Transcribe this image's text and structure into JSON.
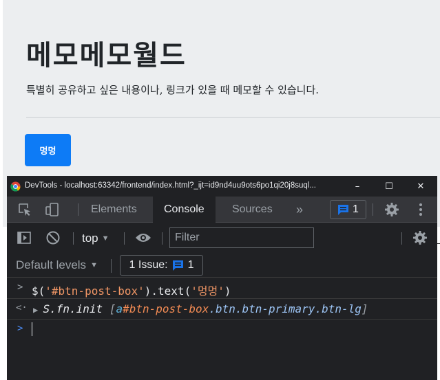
{
  "page": {
    "title": "메모메모월드",
    "lead": "특별히 공유하고 싶은 내용이나, 링크가 있을 때 메모할 수 있습니다.",
    "post_button_label": "멍멍"
  },
  "devtools": {
    "window_title": "DevTools - localhost:63342/frontend/index.html?_ijt=id9nd4uu9ots6po1qi20j8suql...",
    "window_controls": {
      "minimize": "–",
      "maximize": "☐",
      "close": "✕"
    },
    "tabs": [
      {
        "label": "Elements",
        "active": false
      },
      {
        "label": "Console",
        "active": true
      },
      {
        "label": "Sources",
        "active": false
      }
    ],
    "more_tabs": "»",
    "issues_count": "1",
    "toolbar": {
      "context": "top",
      "filter_placeholder": "Filter"
    },
    "levels": {
      "label": "Default levels",
      "issue_label": "1 Issue:",
      "issue_count": "1"
    },
    "console": {
      "input_line": {
        "fn": "$(",
        "arg1": "'#btn-post-box'",
        "mid": ").text(",
        "arg2": "'멍멍'",
        "end": ")"
      },
      "result_line": {
        "obj": "S.fn.init",
        "open": "[",
        "tag": "a",
        "selector": "#btn-post-box",
        "classes": ".btn.btn-primary.btn-lg",
        "close": "]"
      }
    },
    "colors": {
      "background": "#202124",
      "tabbar": "#35363a",
      "accent_blue": "#0d7bf6",
      "string": "#f29766"
    }
  }
}
